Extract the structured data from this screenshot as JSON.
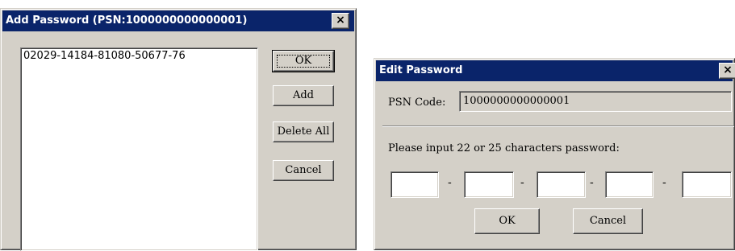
{
  "add_dialog": {
    "title": "Add Password (PSN:1000000000000001)",
    "close_label": "×",
    "list_items": [
      "02029-14184-81080-50677-76"
    ],
    "buttons": {
      "ok": "OK",
      "add": "Add",
      "delete_all": "Delete All",
      "cancel": "Cancel"
    }
  },
  "edit_dialog": {
    "title": "Edit Password",
    "close_label": "×",
    "psn_label": "PSN Code:",
    "psn_value": "1000000000000001",
    "prompt": "Please input 22 or 25 characters password:",
    "fields": [
      "",
      "",
      "",
      "",
      ""
    ],
    "separator": "-",
    "buttons": {
      "ok": "OK",
      "cancel": "Cancel"
    }
  }
}
